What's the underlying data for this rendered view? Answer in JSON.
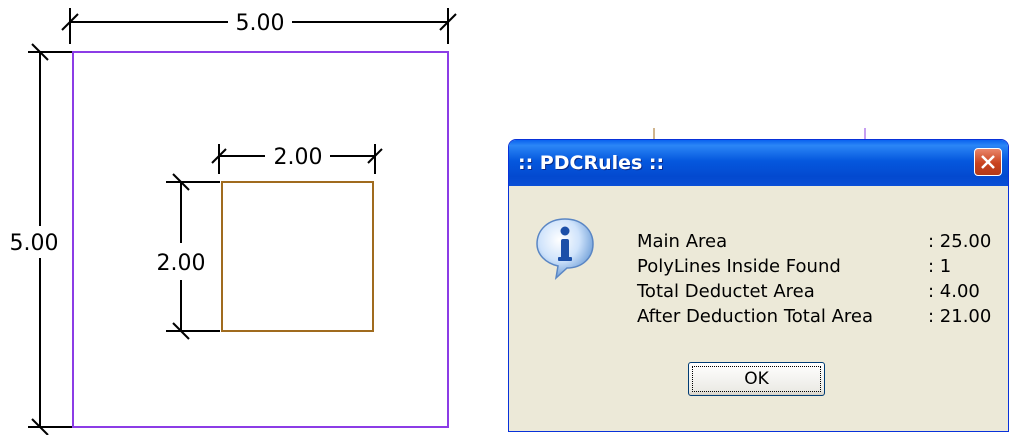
{
  "drawing": {
    "outer_width_dim": "5.00",
    "outer_height_dim": "5.00",
    "inner_width_dim": "2.00",
    "inner_height_dim": "2.00",
    "colors": {
      "outer_rect": "#8c3ce6",
      "inner_rect": "#a06b1e"
    }
  },
  "dialog": {
    "title": ":: PDCRules ::",
    "icon": "info-icon",
    "rows": [
      {
        "label": "Main Area",
        "value": ": 25.00"
      },
      {
        "label": "PolyLines Inside Found",
        "value": ": 1"
      },
      {
        "label": "Total Deductet Area",
        "value": ": 4.00"
      },
      {
        "label": "After Deduction Total Area",
        "value": ": 21.00"
      }
    ],
    "ok_label": "OK"
  }
}
